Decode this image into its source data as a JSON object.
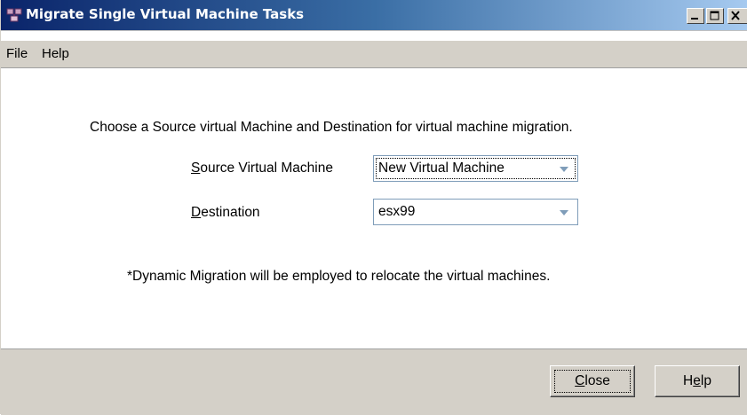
{
  "window": {
    "title": "Migrate Single Virtual Machine Tasks",
    "controls": [
      "minimize-icon",
      "maximize-icon",
      "close-icon"
    ],
    "title_color": "#0a246a"
  },
  "menu": {
    "file": "File",
    "help": "Help"
  },
  "main": {
    "instruction": "Choose a Source virtual Machine and Destination for virtual machine migration.",
    "source_label_mnemonic": "S",
    "source_label_rest": "ource Virtual Machine",
    "source_value": "New Virtual Machine",
    "destination_label_mnemonic": "D",
    "destination_label_rest": "estination",
    "destination_value": "esx99",
    "note": "*Dynamic Migration will be employed to relocate the virtual machines."
  },
  "buttons": {
    "close_mnemonic": "C",
    "close_rest": "lose",
    "help_prefix": "H",
    "help_mnemonic": "e",
    "help_rest": "lp"
  },
  "colors": {
    "panel": "#d4d0c8",
    "combo_border": "#7f9db9",
    "arrow": "#7f9db9"
  }
}
